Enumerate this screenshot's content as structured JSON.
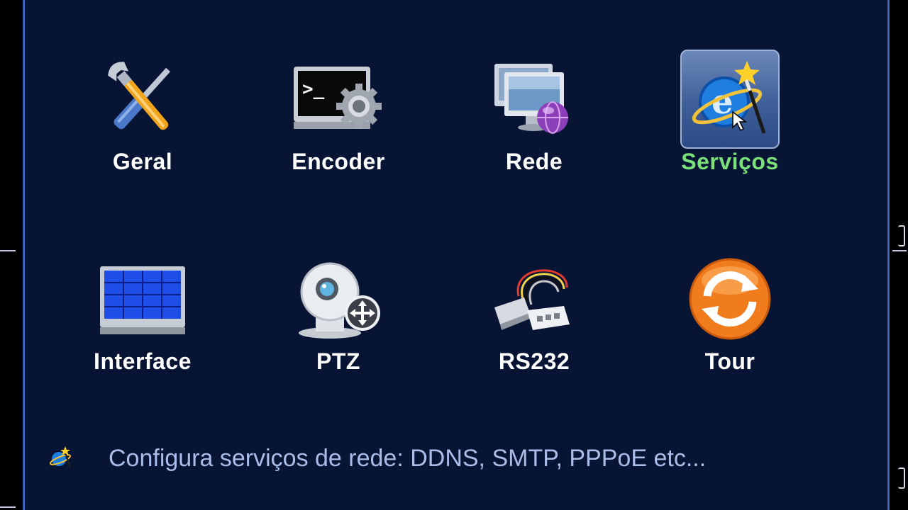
{
  "menu": {
    "selected": "servicos",
    "items": [
      {
        "id": "geral",
        "label": "Geral",
        "icon": "tools-icon"
      },
      {
        "id": "encoder",
        "label": "Encoder",
        "icon": "terminal-gear-icon"
      },
      {
        "id": "rede",
        "label": "Rede",
        "icon": "network-monitors-icon"
      },
      {
        "id": "servicos",
        "label": "Serviços",
        "icon": "internet-wand-icon"
      },
      {
        "id": "interface",
        "label": "Interface",
        "icon": "display-grid-icon"
      },
      {
        "id": "ptz",
        "label": "PTZ",
        "icon": "ptz-camera-icon"
      },
      {
        "id": "rs232",
        "label": "RS232",
        "icon": "serial-cable-icon"
      },
      {
        "id": "tour",
        "label": "Tour",
        "icon": "refresh-cycle-icon"
      }
    ]
  },
  "status": {
    "text": "Configura serviços de rede: DDNS, SMTP, PPPoE etc...",
    "icon": "internet-wand-icon"
  },
  "colors": {
    "panel_bg": "#071433",
    "selected_label": "#7be07a",
    "label": "#ffffff",
    "status_text": "#a9bde8"
  }
}
